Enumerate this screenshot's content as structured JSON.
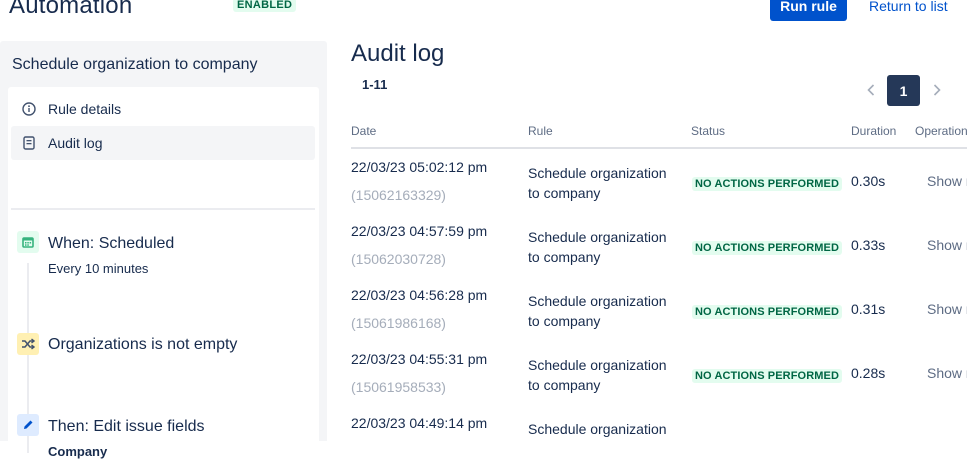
{
  "header": {
    "title": "Automation",
    "status": "ENABLED",
    "run_label": "Run rule",
    "return_label": "Return to list"
  },
  "sidebar": {
    "rule_name": "Schedule organization to company",
    "nav": [
      {
        "label": "Rule details",
        "icon": "info-icon"
      },
      {
        "label": "Audit log",
        "icon": "document-icon"
      }
    ],
    "components": [
      {
        "title": "When: Scheduled",
        "subtitle": "Every 10 minutes",
        "icon": "calendar-icon",
        "color": "#36b37e",
        "bg": "#e3fcef"
      },
      {
        "title": "Organizations is not empty",
        "subtitle": "",
        "icon": "shuffle-icon",
        "color": "#ff8b00",
        "bg": "#fff0b3"
      },
      {
        "title": "Then: Edit issue fields",
        "subtitle": "Company",
        "icon": "pencil-icon",
        "color": "#0052cc",
        "bg": "#deebff"
      }
    ]
  },
  "main": {
    "title": "Audit log",
    "range": "1-11",
    "pagination": {
      "current": "1"
    },
    "columns": [
      "Date",
      "Rule",
      "Status",
      "Duration",
      "Operation"
    ],
    "rows": [
      {
        "date": "22/03/23 05:02:12 pm",
        "id": "(15062163329)",
        "rule": [
          "Schedule organization",
          "to company"
        ],
        "status": "NO ACTIONS PERFORMED",
        "duration": "0.30s",
        "op": "Show more"
      },
      {
        "date": "22/03/23 04:57:59 pm",
        "id": "(15062030728)",
        "rule": [
          "Schedule organization",
          "to company"
        ],
        "status": "NO ACTIONS PERFORMED",
        "duration": "0.33s",
        "op": "Show more"
      },
      {
        "date": "22/03/23 04:56:28 pm",
        "id": "(15061986168)",
        "rule": [
          "Schedule organization",
          "to company"
        ],
        "status": "NO ACTIONS PERFORMED",
        "duration": "0.31s",
        "op": "Show more"
      },
      {
        "date": "22/03/23 04:55:31 pm",
        "id": "(15061958533)",
        "rule": [
          "Schedule organization",
          "to company"
        ],
        "status": "NO ACTIONS PERFORMED",
        "duration": "0.28s",
        "op": "Show more"
      },
      {
        "date": "22/03/23 04:49:14 pm",
        "id": "",
        "rule": [
          "Schedule organization",
          ""
        ],
        "status": "",
        "duration": "",
        "op": ""
      }
    ]
  },
  "colors": {
    "primary": "#0052cc",
    "success_bg": "#e3fcef",
    "success_text": "#006644",
    "pagination_active": "#253858"
  }
}
